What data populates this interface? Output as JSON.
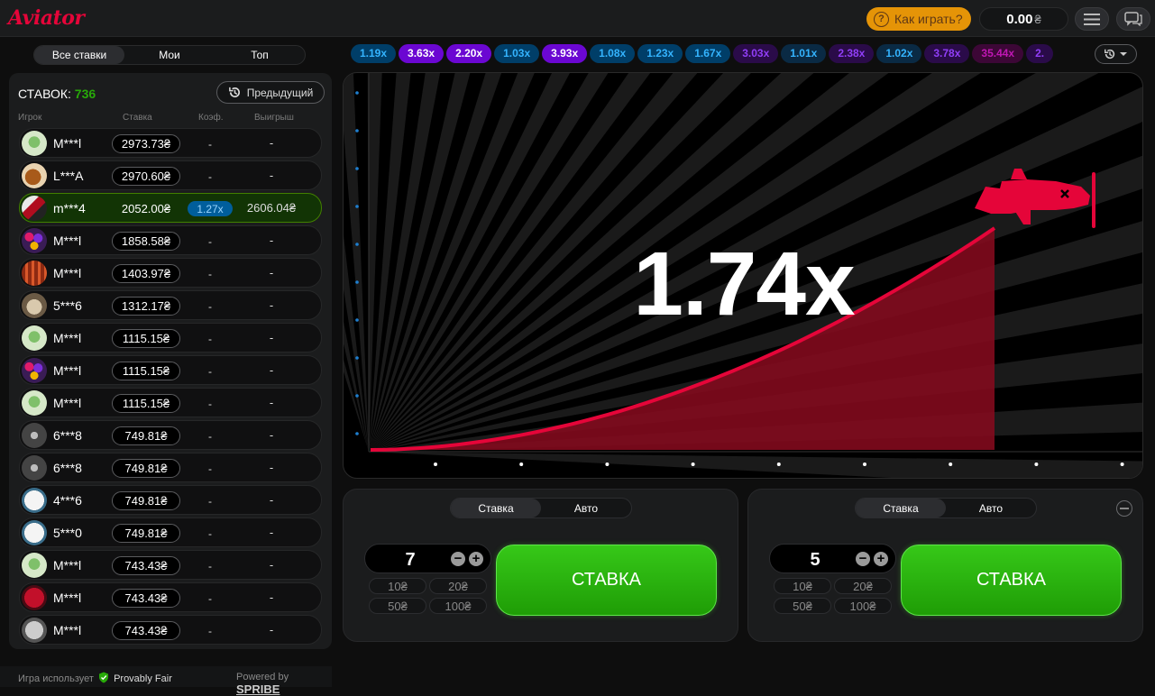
{
  "app": {
    "logo": "Aviator"
  },
  "header": {
    "how_to_play": "Как играть?",
    "balance": "0.00",
    "currency": "₴"
  },
  "left_tabs": [
    {
      "label": "Все ставки",
      "active": true
    },
    {
      "label": "Мои",
      "active": false
    },
    {
      "label": "Топ",
      "active": false
    }
  ],
  "bets": {
    "title": "СТАВОК:",
    "count": "736",
    "previous": "Предыдущий",
    "columns": {
      "player": "Игрок",
      "bet": "Ставка",
      "coef": "Коэф.",
      "win": "Выигрыш"
    },
    "rows": [
      {
        "user": "M***l",
        "bet": "2973.73₴",
        "coef": "-",
        "win": "-",
        "avatar": "clover",
        "won": false
      },
      {
        "user": "L***A",
        "bet": "2970.60₴",
        "coef": "-",
        "win": "-",
        "avatar": "dog",
        "won": false
      },
      {
        "user": "m***4",
        "bet": "2052.00₴",
        "coef": "1.27x",
        "win": "2606.04₴",
        "avatar": "car",
        "won": true
      },
      {
        "user": "M***l",
        "bet": "1858.58₴",
        "coef": "-",
        "win": "-",
        "avatar": "balloons",
        "won": false
      },
      {
        "user": "M***l",
        "bet": "1403.97₴",
        "coef": "-",
        "win": "-",
        "avatar": "stripes",
        "won": false
      },
      {
        "user": "5***6",
        "bet": "1312.17₴",
        "coef": "-",
        "win": "-",
        "avatar": "cake",
        "won": false
      },
      {
        "user": "M***l",
        "bet": "1115.15₴",
        "coef": "-",
        "win": "-",
        "avatar": "clover",
        "won": false
      },
      {
        "user": "M***l",
        "bet": "1115.15₴",
        "coef": "-",
        "win": "-",
        "avatar": "balloons",
        "won": false
      },
      {
        "user": "M***l",
        "bet": "1115.15₴",
        "coef": "-",
        "win": "-",
        "avatar": "clover",
        "won": false
      },
      {
        "user": "6***8",
        "bet": "749.81₴",
        "coef": "-",
        "win": "-",
        "avatar": "propeller",
        "won": false
      },
      {
        "user": "6***8",
        "bet": "749.81₴",
        "coef": "-",
        "win": "-",
        "avatar": "propeller",
        "won": false
      },
      {
        "user": "4***6",
        "bet": "749.81₴",
        "coef": "-",
        "win": "-",
        "avatar": "cat",
        "won": false
      },
      {
        "user": "5***0",
        "bet": "749.81₴",
        "coef": "-",
        "win": "-",
        "avatar": "cat",
        "won": false
      },
      {
        "user": "M***l",
        "bet": "743.43₴",
        "coef": "-",
        "win": "-",
        "avatar": "clover",
        "won": false
      },
      {
        "user": "M***l",
        "bet": "743.43₴",
        "coef": "-",
        "win": "-",
        "avatar": "redball",
        "won": false
      },
      {
        "user": "M***l",
        "bet": "743.43₴",
        "coef": "-",
        "win": "-",
        "avatar": "football",
        "won": false
      }
    ]
  },
  "footer": {
    "uses": "Игра использует",
    "provably": "Provably Fair",
    "powered": "Powered by",
    "brand": "SPRIBE"
  },
  "history": [
    {
      "v": "1.19x",
      "c": "#34b4ff",
      "bg": "#003e68"
    },
    {
      "v": "3.63x",
      "c": "#ffffff",
      "bg": "#6b07d2"
    },
    {
      "v": "2.20x",
      "c": "#ffffff",
      "bg": "#6b07d2"
    },
    {
      "v": "1.03x",
      "c": "#34b4ff",
      "bg": "#003e68"
    },
    {
      "v": "3.93x",
      "c": "#ffffff",
      "bg": "#6b07d2"
    },
    {
      "v": "1.08x",
      "c": "#34b4ff",
      "bg": "#003e68"
    },
    {
      "v": "1.23x",
      "c": "#34b4ff",
      "bg": "#003e68"
    },
    {
      "v": "1.67x",
      "c": "#34b4ff",
      "bg": "#003e68"
    },
    {
      "v": "3.03x",
      "c": "#913ef8",
      "bg": "#2a0b49"
    },
    {
      "v": "1.01x",
      "c": "#34b4ff",
      "bg": "#0a2a44"
    },
    {
      "v": "2.38x",
      "c": "#913ef8",
      "bg": "#2a0b49"
    },
    {
      "v": "1.02x",
      "c": "#34b4ff",
      "bg": "#0a2a44"
    },
    {
      "v": "3.78x",
      "c": "#913ef8",
      "bg": "#2a0b49"
    },
    {
      "v": "35.44x",
      "c": "#c017b4",
      "bg": "#3c0736"
    },
    {
      "v": "2.",
      "c": "#913ef8",
      "bg": "#2a0b49"
    }
  ],
  "game": {
    "multiplier": "1.74x",
    "accent": "#e50539"
  },
  "bet_panels": [
    {
      "tab_bet": "Ставка",
      "tab_auto": "Авто",
      "value": "7",
      "quick": [
        "10₴",
        "20₴",
        "50₴",
        "100₴"
      ],
      "button": "СТАВКА"
    },
    {
      "tab_bet": "Ставка",
      "tab_auto": "Авто",
      "value": "5",
      "quick": [
        "10₴",
        "20₴",
        "50₴",
        "100₴"
      ],
      "button": "СТАВКА"
    }
  ]
}
